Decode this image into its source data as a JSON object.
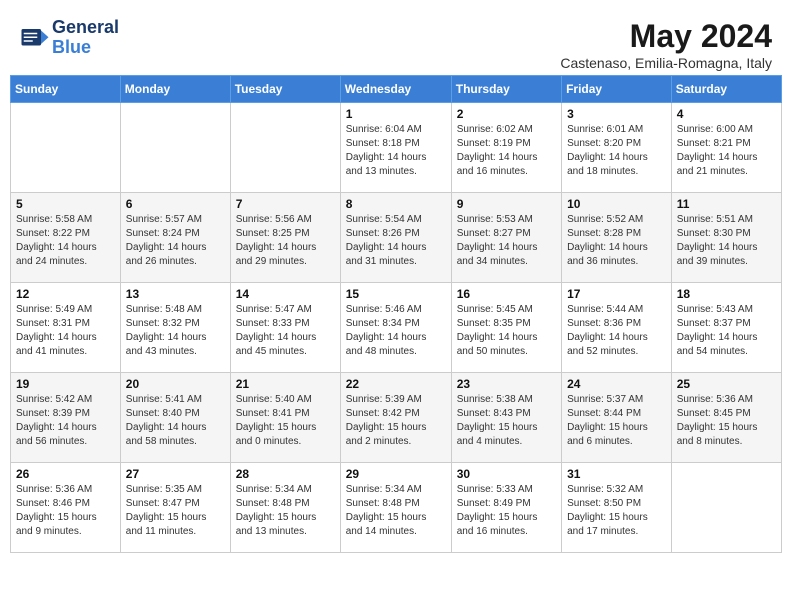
{
  "header": {
    "logo_line1": "General",
    "logo_line2": "Blue",
    "month_title": "May 2024",
    "location": "Castenaso, Emilia-Romagna, Italy"
  },
  "weekdays": [
    "Sunday",
    "Monday",
    "Tuesday",
    "Wednesday",
    "Thursday",
    "Friday",
    "Saturday"
  ],
  "weeks": [
    [
      {
        "day": "",
        "info": ""
      },
      {
        "day": "",
        "info": ""
      },
      {
        "day": "",
        "info": ""
      },
      {
        "day": "1",
        "info": "Sunrise: 6:04 AM\nSunset: 8:18 PM\nDaylight: 14 hours\nand 13 minutes."
      },
      {
        "day": "2",
        "info": "Sunrise: 6:02 AM\nSunset: 8:19 PM\nDaylight: 14 hours\nand 16 minutes."
      },
      {
        "day": "3",
        "info": "Sunrise: 6:01 AM\nSunset: 8:20 PM\nDaylight: 14 hours\nand 18 minutes."
      },
      {
        "day": "4",
        "info": "Sunrise: 6:00 AM\nSunset: 8:21 PM\nDaylight: 14 hours\nand 21 minutes."
      }
    ],
    [
      {
        "day": "5",
        "info": "Sunrise: 5:58 AM\nSunset: 8:22 PM\nDaylight: 14 hours\nand 24 minutes."
      },
      {
        "day": "6",
        "info": "Sunrise: 5:57 AM\nSunset: 8:24 PM\nDaylight: 14 hours\nand 26 minutes."
      },
      {
        "day": "7",
        "info": "Sunrise: 5:56 AM\nSunset: 8:25 PM\nDaylight: 14 hours\nand 29 minutes."
      },
      {
        "day": "8",
        "info": "Sunrise: 5:54 AM\nSunset: 8:26 PM\nDaylight: 14 hours\nand 31 minutes."
      },
      {
        "day": "9",
        "info": "Sunrise: 5:53 AM\nSunset: 8:27 PM\nDaylight: 14 hours\nand 34 minutes."
      },
      {
        "day": "10",
        "info": "Sunrise: 5:52 AM\nSunset: 8:28 PM\nDaylight: 14 hours\nand 36 minutes."
      },
      {
        "day": "11",
        "info": "Sunrise: 5:51 AM\nSunset: 8:30 PM\nDaylight: 14 hours\nand 39 minutes."
      }
    ],
    [
      {
        "day": "12",
        "info": "Sunrise: 5:49 AM\nSunset: 8:31 PM\nDaylight: 14 hours\nand 41 minutes."
      },
      {
        "day": "13",
        "info": "Sunrise: 5:48 AM\nSunset: 8:32 PM\nDaylight: 14 hours\nand 43 minutes."
      },
      {
        "day": "14",
        "info": "Sunrise: 5:47 AM\nSunset: 8:33 PM\nDaylight: 14 hours\nand 45 minutes."
      },
      {
        "day": "15",
        "info": "Sunrise: 5:46 AM\nSunset: 8:34 PM\nDaylight: 14 hours\nand 48 minutes."
      },
      {
        "day": "16",
        "info": "Sunrise: 5:45 AM\nSunset: 8:35 PM\nDaylight: 14 hours\nand 50 minutes."
      },
      {
        "day": "17",
        "info": "Sunrise: 5:44 AM\nSunset: 8:36 PM\nDaylight: 14 hours\nand 52 minutes."
      },
      {
        "day": "18",
        "info": "Sunrise: 5:43 AM\nSunset: 8:37 PM\nDaylight: 14 hours\nand 54 minutes."
      }
    ],
    [
      {
        "day": "19",
        "info": "Sunrise: 5:42 AM\nSunset: 8:39 PM\nDaylight: 14 hours\nand 56 minutes."
      },
      {
        "day": "20",
        "info": "Sunrise: 5:41 AM\nSunset: 8:40 PM\nDaylight: 14 hours\nand 58 minutes."
      },
      {
        "day": "21",
        "info": "Sunrise: 5:40 AM\nSunset: 8:41 PM\nDaylight: 15 hours\nand 0 minutes."
      },
      {
        "day": "22",
        "info": "Sunrise: 5:39 AM\nSunset: 8:42 PM\nDaylight: 15 hours\nand 2 minutes."
      },
      {
        "day": "23",
        "info": "Sunrise: 5:38 AM\nSunset: 8:43 PM\nDaylight: 15 hours\nand 4 minutes."
      },
      {
        "day": "24",
        "info": "Sunrise: 5:37 AM\nSunset: 8:44 PM\nDaylight: 15 hours\nand 6 minutes."
      },
      {
        "day": "25",
        "info": "Sunrise: 5:36 AM\nSunset: 8:45 PM\nDaylight: 15 hours\nand 8 minutes."
      }
    ],
    [
      {
        "day": "26",
        "info": "Sunrise: 5:36 AM\nSunset: 8:46 PM\nDaylight: 15 hours\nand 9 minutes."
      },
      {
        "day": "27",
        "info": "Sunrise: 5:35 AM\nSunset: 8:47 PM\nDaylight: 15 hours\nand 11 minutes."
      },
      {
        "day": "28",
        "info": "Sunrise: 5:34 AM\nSunset: 8:48 PM\nDaylight: 15 hours\nand 13 minutes."
      },
      {
        "day": "29",
        "info": "Sunrise: 5:34 AM\nSunset: 8:48 PM\nDaylight: 15 hours\nand 14 minutes."
      },
      {
        "day": "30",
        "info": "Sunrise: 5:33 AM\nSunset: 8:49 PM\nDaylight: 15 hours\nand 16 minutes."
      },
      {
        "day": "31",
        "info": "Sunrise: 5:32 AM\nSunset: 8:50 PM\nDaylight: 15 hours\nand 17 minutes."
      },
      {
        "day": "",
        "info": ""
      }
    ]
  ]
}
